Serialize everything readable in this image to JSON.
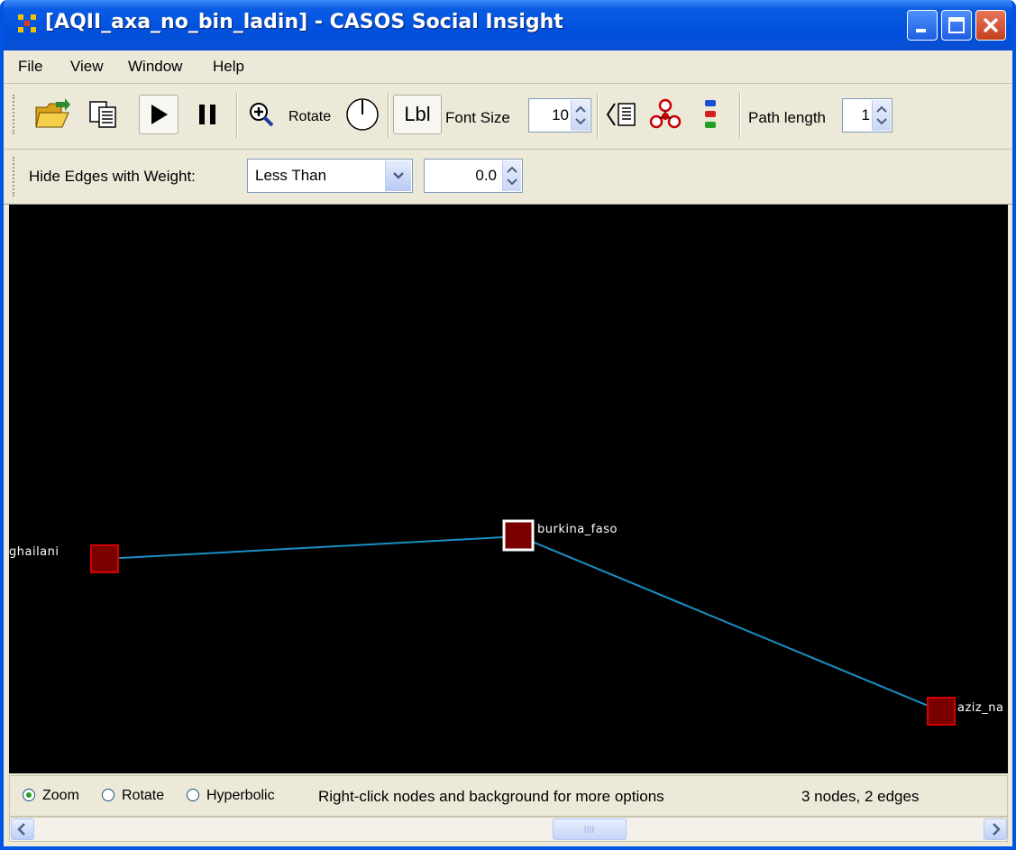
{
  "window": {
    "title": "[AQII_axa_no_bin_ladin] - CASOS Social Insight",
    "icon": "casos-app-icon",
    "controls": [
      "minimize-icon",
      "maximize-icon",
      "close-icon"
    ]
  },
  "menu": [
    "File",
    "View",
    "Window",
    "Help"
  ],
  "toolbar": {
    "rotate_label": "Rotate",
    "lbl_label": "Lbl",
    "font_size_label": "Font Size",
    "font_size_value": "10",
    "path_length_label": "Path length",
    "path_length_value": "1",
    "icons": [
      "open-folder-icon",
      "copy-icon",
      "play-icon",
      "pause-icon",
      "zoom-in-icon",
      "rotate-dial-icon",
      "label-toggle-icon",
      "legend-icon",
      "node-group-icon",
      "color-bars-icon"
    ]
  },
  "filter": {
    "label": "Hide Edges with Weight:",
    "comparison": "Less Than",
    "value": "0.0"
  },
  "graph": {
    "background": "#000000",
    "edge_color": "#1a8fc4",
    "node_color": "#7a0000",
    "nodes": [
      {
        "id": "ghailani",
        "label": "ghailani",
        "selected": false
      },
      {
        "id": "burkina_faso",
        "label": "burkina_faso",
        "selected": true
      },
      {
        "id": "aziz_na",
        "label": "aziz_na",
        "selected": false
      }
    ],
    "edges": [
      {
        "from": "ghailani",
        "to": "burkina_faso"
      },
      {
        "from": "burkina_faso",
        "to": "aziz_na"
      }
    ]
  },
  "status": {
    "modes": [
      "Zoom",
      "Rotate",
      "Hyperbolic"
    ],
    "selected_mode": "Zoom",
    "hint": "Right-click nodes and background for more options",
    "count": "3 nodes, 2 edges"
  }
}
